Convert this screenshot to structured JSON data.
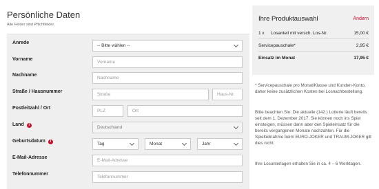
{
  "personal": {
    "title": "Persönliche Daten",
    "subtitle": "Alle Felder sind Pflichtfelder.",
    "fields": {
      "anrede": {
        "label": "Anrede",
        "value": "-- Bitte wählen --"
      },
      "vorname": {
        "label": "Vorname",
        "placeholder": "Vorname"
      },
      "nachname": {
        "label": "Nachname",
        "placeholder": "Nachname"
      },
      "strasse": {
        "label": "Straße / Hausnummer",
        "placeholder_street": "Straße",
        "placeholder_number": "Haus-Nr."
      },
      "plz_ort": {
        "label": "Postleitzahl / Ort",
        "placeholder_plz": "PLZ",
        "placeholder_ort": "Ort"
      },
      "land": {
        "label": "Land",
        "value": "Deutschland"
      },
      "geburtsdatum": {
        "label": "Geburtsdatum",
        "day": "Tag",
        "month": "Monat",
        "year": "Jahr"
      },
      "email": {
        "label": "E-Mail-Adresse",
        "placeholder": "E-Mail-Adresse"
      },
      "telefon": {
        "label": "Telefonnummer",
        "placeholder": "Telefonnummer"
      }
    },
    "info_icon_glyph": "i"
  },
  "summary": {
    "title": "Ihre Produktauswahl",
    "change_label": "Ändern",
    "rows": [
      {
        "qty": "1 x",
        "desc": "Losanteil mit versch. Los-Nr.",
        "price": "15,00 €"
      },
      {
        "qty": "",
        "desc": "Servicepauschale*",
        "price": "2,95 €"
      },
      {
        "qty": "",
        "desc": "Einsatz im Monat",
        "price": "17,95 €"
      }
    ],
    "notes": [
      "* Servicepauschale pro Monat/Klasse und Kunden-Konto, daher keine zusätzlichen Kosten bei Losnachbestellung.",
      "Bitte beachten Sie: Die aktuelle (142.) Lotterie läuft bereits seit dem 1. Dezember 2017. Sie können noch ins Spiel einsteigen, müssen dann aber den Spieleinsatz für die bereits vergangenen Monate nachzahlen. Für die Spielteilnahme beim EURO-JOKER und TRAUM-JOKER gilt dies nicht.",
      "Ihre Losunterlagen erhalten Sie in ca. 4 – 6 Werktagen."
    ]
  },
  "colors": {
    "accent": "#c4122f",
    "panel": "#efefef"
  }
}
